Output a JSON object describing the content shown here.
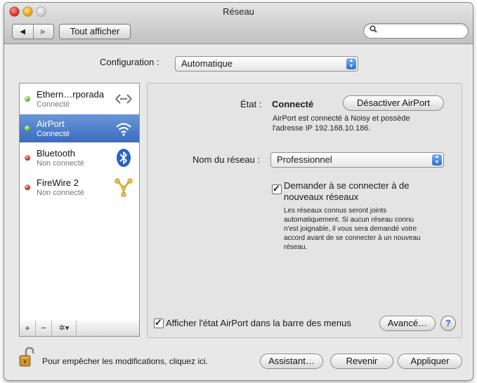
{
  "window": {
    "title": "Réseau"
  },
  "toolbar": {
    "back_glyph": "◀",
    "forward_glyph": "▶",
    "show_all_label": "Tout afficher",
    "search_value": "",
    "search_placeholder": ""
  },
  "configuration": {
    "label": "Configuration :",
    "value": "Automatique"
  },
  "services": [
    {
      "name": "Ethern…rporada",
      "status": "Connecté",
      "dot": "green",
      "icon": "ethernet-icon"
    },
    {
      "name": "AirPort",
      "status": "Connecté",
      "dot": "green",
      "icon": "wifi-icon",
      "selected": true
    },
    {
      "name": "Bluetooth",
      "status": "Non connecté",
      "dot": "red",
      "icon": "bluetooth-icon"
    },
    {
      "name": "FireWire 2",
      "status": "Non connecté",
      "dot": "red",
      "icon": "firewire-icon"
    }
  ],
  "sidebar_bar": {
    "add": "+",
    "remove": "−",
    "action": "✲▾"
  },
  "detail": {
    "status_label": "État :",
    "status_value": "Connecté",
    "disable_button": "Désactiver AirPort",
    "status_desc_line1": "AirPort est connecté à Noisy et possède",
    "status_desc_line2": "l'adresse IP 192.168.10.186.",
    "network_label": "Nom du réseau :",
    "network_value": "Professionnel",
    "ask_join_line1": "Demander à se connecter à de",
    "ask_join_line2": "nouveaux réseaux",
    "ask_join_checked": true,
    "ask_desc_lines": [
      "Les réseaux connus seront joints",
      "automatiquement. Si aucun réseau connu",
      "n'est joignable, il vous sera demandé votre",
      "accord avant de se connecter à un nouveau",
      "réseau."
    ],
    "show_menu_label": "Afficher l'état AirPort dans la barre des menus",
    "show_menu_checked": true,
    "advanced_button": "Avancé…",
    "help_glyph": "?"
  },
  "footer": {
    "lock_text": "Pour empêcher les modifications, cliquez ici.",
    "assistant_button": "Assistant…",
    "revert_button": "Revenir",
    "apply_button": "Appliquer"
  },
  "colors": {
    "selection": "#3a6bbf",
    "status_green": "#5db82a",
    "status_red": "#d32b1f",
    "popup_blue": "#2f6fd4"
  }
}
